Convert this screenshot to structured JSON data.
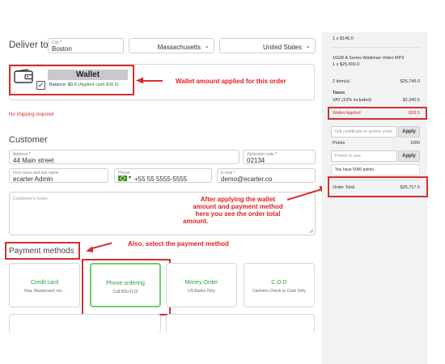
{
  "deliver": {
    "label": "Deliver to",
    "city_label": "City",
    "city_value": "Boston",
    "state_value": "Massachusetts",
    "country_value": "United States"
  },
  "wallet": {
    "title": "Wallet",
    "balance_prefix": "Balance: $0.0",
    "applied_text": "(Applied cash $28.5)",
    "checked": true
  },
  "annotations": {
    "wallet_note": "Wallet amount applied for this order",
    "order_note_lines": [
      "After applying the wallet",
      "amount and payment method",
      "here you see the order total",
      "amount."
    ],
    "payment_note": "Also, select the payment method"
  },
  "shipping": {
    "notice": "No shipping required"
  },
  "customer": {
    "heading": "Customer",
    "address_label": "Address",
    "address_value": "44 Main street",
    "zip_label": "Zip/postal code",
    "zip_value": "02134",
    "name_label": "First name and last name",
    "name_value": "ecarter Admin",
    "phone_label": "Phone",
    "phone_value": "+55 55 5555-5555",
    "email_label": "E-mail",
    "email_value": "demo@ecarter.co",
    "notes_placeholder": "Customer's notes"
  },
  "payment": {
    "heading": "Payment methods",
    "methods": [
      {
        "name": "Credit card",
        "desc": "Visa, Mastercard, etc..."
      },
      {
        "name": "Phone ordering",
        "desc": "Call 555-0123"
      },
      {
        "name": "Money Order",
        "desc": "US Banks Only"
      },
      {
        "name": "C.O.D",
        "desc": "Cashiers Check or Cash Only"
      }
    ]
  },
  "summary": {
    "item_line_1": "1 x $146.0",
    "item_name": "16GB A Series Walkman Video MP3",
    "item_line_2": "1 x $25,600.0",
    "items_label": "2 item(s)",
    "items_total": "$25,746.0",
    "taxes_label": "Taxes",
    "vat_label": "VAT (10% included)",
    "vat_value": "$2,340.5",
    "wallet_label": "Wallet Applied",
    "wallet_value": "-$28.5",
    "gift_placeholder": "Gift certificate or promo code",
    "apply_label": "Apply",
    "points_label": "Points",
    "points_value": "1000",
    "points_placeholder": "Points to use",
    "points_note": "You have 5000 points.",
    "total_label": "Order Total",
    "total_value": "$25,717.5"
  },
  "colors": {
    "annotation": "#e02020",
    "accent_green": "#2e9e3a",
    "selected_border": "#6fcf71"
  }
}
